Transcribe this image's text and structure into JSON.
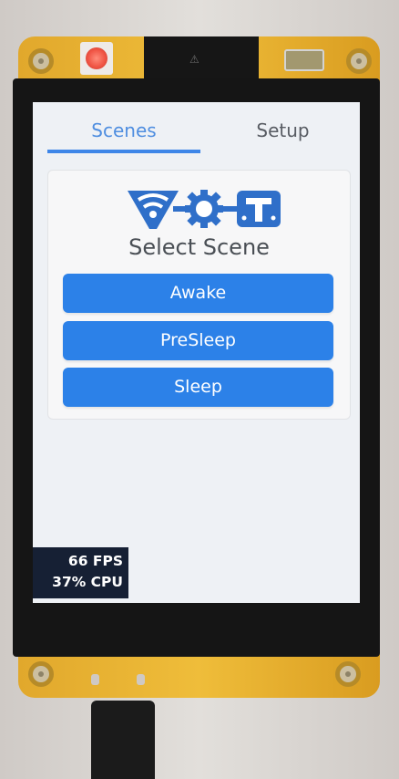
{
  "tabs": [
    {
      "label": "Scenes",
      "active": true
    },
    {
      "label": "Setup",
      "active": false
    }
  ],
  "panel": {
    "logo": "wot-logo",
    "title": "Select Scene",
    "buttons": [
      "Awake",
      "PreSleep",
      "Sleep"
    ]
  },
  "perf": {
    "fps": "66 FPS",
    "cpu": "37% CPU"
  },
  "colors": {
    "accent": "#2c81e8",
    "tab_active_text": "#4f8ee0",
    "tab_inactive_text": "#585c63",
    "screen_bg": "#eef1f5",
    "perf_bg": "#162034",
    "led": "#f05545"
  }
}
